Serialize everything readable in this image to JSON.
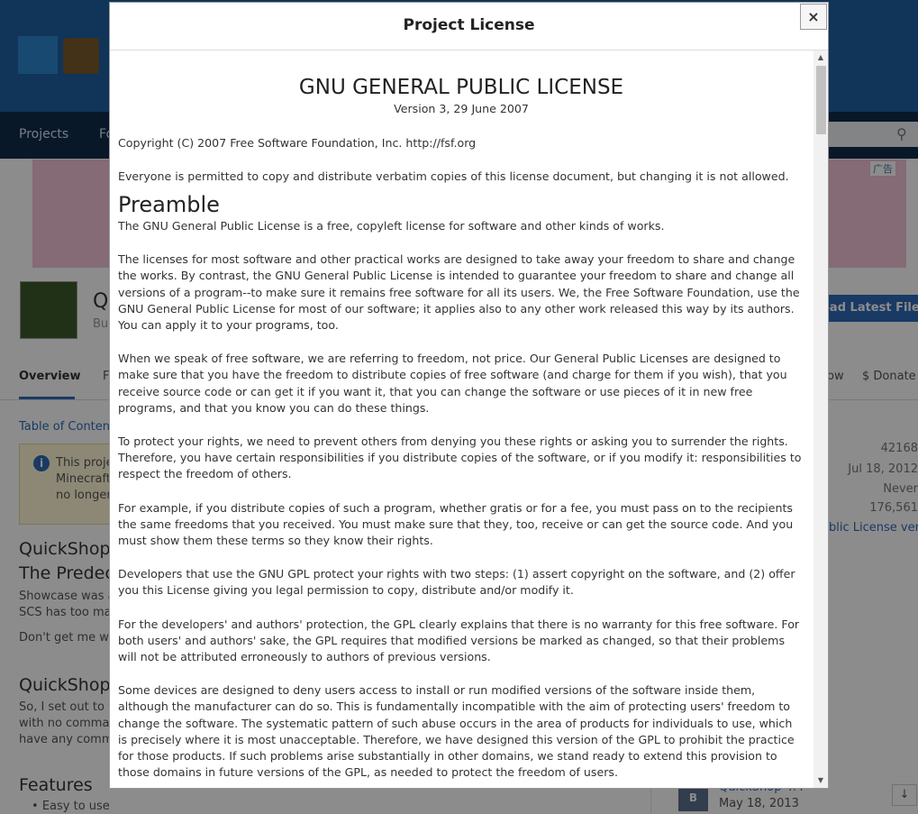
{
  "background": {
    "nav": {
      "projects": "Projects",
      "fo": "Fo"
    },
    "ad_label": "广告",
    "project": {
      "title": "Q",
      "author": "Bu",
      "download": "oad Latest File"
    },
    "tabs": {
      "overview": "Overview",
      "f": "F",
      "follow": "ow",
      "donate": "$ Donate"
    },
    "toc": "Table of Content",
    "info": [
      "This proje",
      "Minecraft",
      "no longer"
    ],
    "headings": {
      "quickshop1": "QuickShop",
      "predece": "The Predece",
      "quickshop2": "QuickShop",
      "features": "Features"
    },
    "paras": {
      "show1": "Showcase was al",
      "show2": "SCS has too mar",
      "dont": "Don't get me wr",
      "so1": "So, I set out to w",
      "so2": "with no comman",
      "so3": "have any comma"
    },
    "features_item": "Easy to use",
    "sidebar": {
      "id": "42168",
      "created": "Jul 18, 2012",
      "updated": "Never",
      "downloads": "176,561",
      "license": "blic License ver..."
    },
    "file": {
      "badge": "B",
      "name": "QuickShop 4.4",
      "date": "May 18, 2013"
    },
    "colors": {
      "header": "#1f5fa3",
      "nav": "#122c4b",
      "accent": "#2e6bb6"
    }
  },
  "modal": {
    "title": "Project License",
    "close_label": "×",
    "license_title": "GNU GENERAL PUBLIC LICENSE",
    "version": "Version 3, 29 June 2007",
    "paragraphs_intro": [
      "Copyright (C) 2007 Free Software Foundation, Inc. http://fsf.org",
      "Everyone is permitted to copy and distribute verbatim copies of this license document, but changing it is not allowed."
    ],
    "preamble_heading": "Preamble",
    "paragraphs": [
      "The GNU General Public License is a free, copyleft license for software and other kinds of works.",
      "The licenses for most software and other practical works are designed to take away your freedom to share and change the works. By contrast, the GNU General Public License is intended to guarantee your freedom to share and change all versions of a program--to make sure it remains free software for all its users. We, the Free Software Foundation, use the GNU General Public License for most of our software; it applies also to any other work released this way by its authors. You can apply it to your programs, too.",
      "When we speak of free software, we are referring to freedom, not price. Our General Public Licenses are designed to make sure that you have the freedom to distribute copies of free software (and charge for them if you wish), that you receive source code or can get it if you want it, that you can change the software or use pieces of it in new free programs, and that you know you can do these things.",
      "To protect your rights, we need to prevent others from denying you these rights or asking you to surrender the rights. Therefore, you have certain responsibilities if you distribute copies of the software, or if you modify it: responsibilities to respect the freedom of others.",
      "For example, if you distribute copies of such a program, whether gratis or for a fee, you must pass on to the recipients the same freedoms that you received. You must make sure that they, too, receive or can get the source code. And you must show them these terms so they know their rights.",
      "Developers that use the GNU GPL protect your rights with two steps: (1) assert copyright on the software, and (2) offer you this License giving you legal permission to copy, distribute and/or modify it.",
      "For the developers' and authors' protection, the GPL clearly explains that there is no warranty for this free software. For both users' and authors' sake, the GPL requires that modified versions be marked as changed, so that their problems will not be attributed erroneously to authors of previous versions.",
      "Some devices are designed to deny users access to install or run modified versions of the software inside them, although the manufacturer can do so. This is fundamentally incompatible with the aim of protecting users' freedom to change the software. The systematic pattern of such abuse occurs in the area of products for individuals to use, which is precisely where it is most unacceptable. Therefore, we have designed this version of the GPL to prohibit the practice for those products. If such problems arise substantially in other domains, we stand ready to extend this provision to those domains in future versions of the GPL, as needed to protect the freedom of users."
    ],
    "scroll_position": 0.0
  }
}
